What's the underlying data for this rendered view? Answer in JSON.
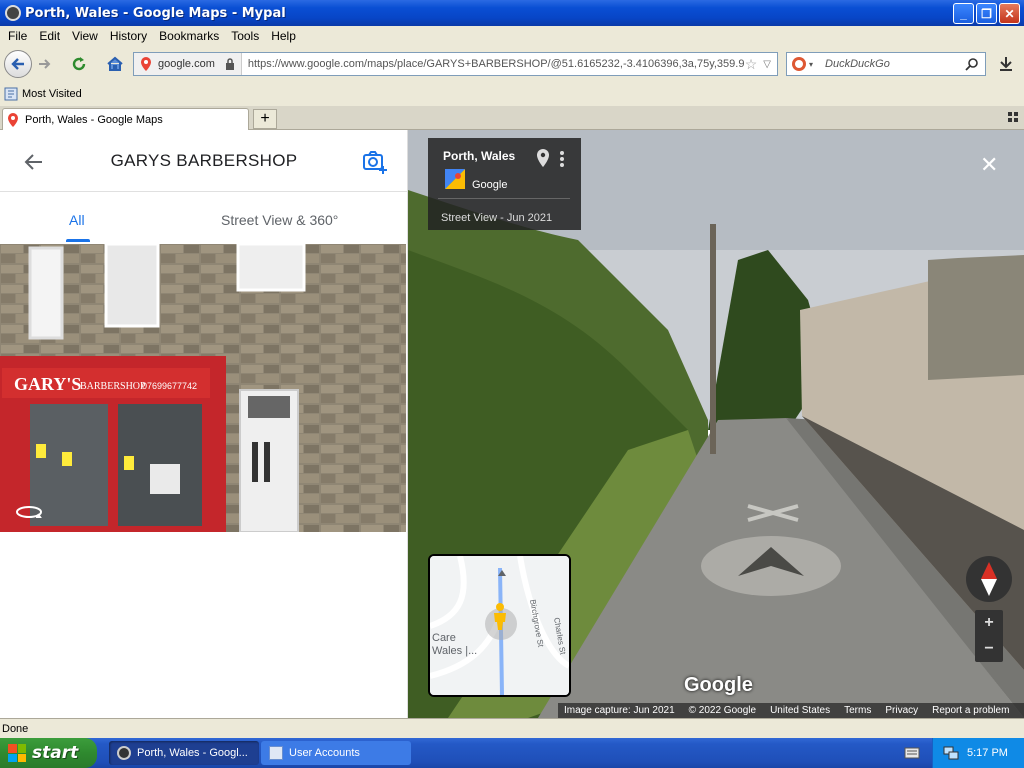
{
  "window": {
    "title": "Porth, Wales - Google Maps - Mypal",
    "minimize": "_",
    "maximize": "❐",
    "close": "✕"
  },
  "menu": [
    "File",
    "Edit",
    "View",
    "History",
    "Bookmarks",
    "Tools",
    "Help"
  ],
  "navbar": {
    "site_identity": "google.com",
    "url": "https://www.google.com/maps/place/GARYS+BARBERSHOP/@51.6165232,-3.4106396,3a,75y,359.9",
    "search_placeholder": "DuckDuckGo"
  },
  "bookmarks": {
    "most_visited": "Most Visited"
  },
  "tabs": [
    {
      "label": "Porth, Wales - Google Maps"
    }
  ],
  "place_panel": {
    "title": "GARYS BARBERSHOP",
    "tabs": [
      {
        "label": "All"
      },
      {
        "label": "Street View & 360°"
      }
    ],
    "storefront_sign": "GARY'S",
    "storefront_subtitle": "BARBERSHOP",
    "storefront_phone": "07699677742"
  },
  "streetview": {
    "place": "Porth, Wales",
    "brand": "Google",
    "date": "Street View - Jun 2021",
    "logo": "Google",
    "minimap_labels": [
      "Care",
      "Wales |...",
      "Birchgrove St",
      "Charles St"
    ],
    "zoom_in": "+",
    "zoom_out": "−",
    "attribution": [
      "Image capture: Jun 2021",
      "© 2022 Google",
      "United States",
      "Terms",
      "Privacy",
      "Report a problem"
    ]
  },
  "statusbar": {
    "text": "Done"
  },
  "taskbar": {
    "start": "start",
    "tasks": [
      {
        "label": "Porth, Wales - Googl..."
      },
      {
        "label": "User Accounts"
      }
    ],
    "clock": "5:17 PM"
  },
  "colors": {
    "accent": "#1a73e8",
    "xp_blue": "#0a4fd4",
    "start_green": "#2f8a2f"
  }
}
